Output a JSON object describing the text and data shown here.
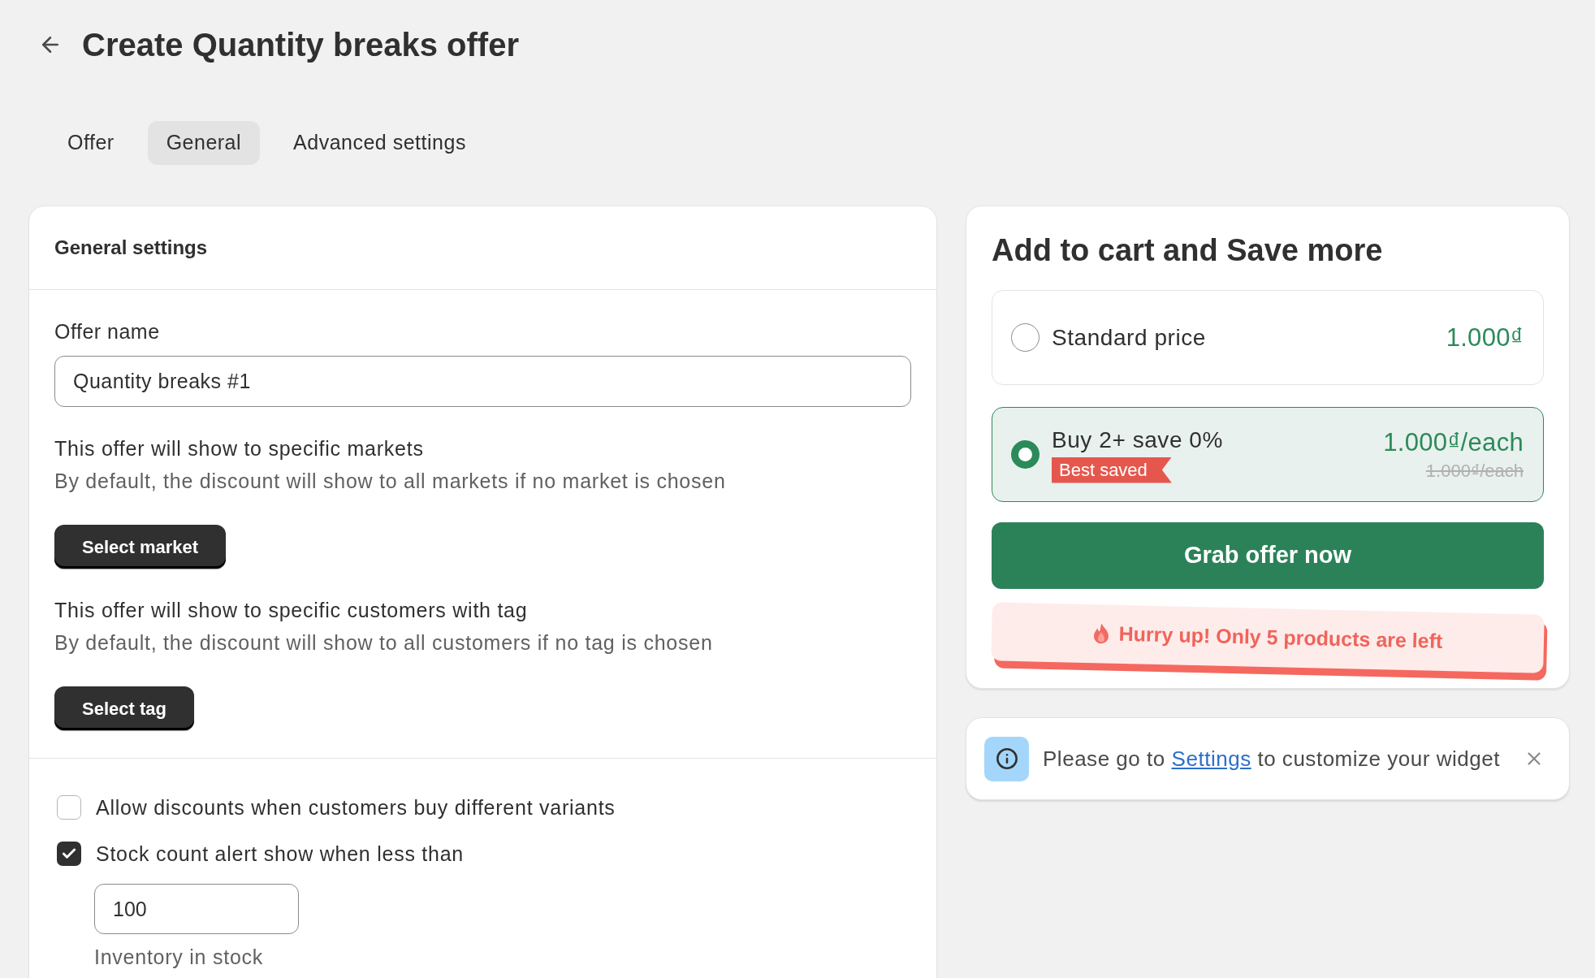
{
  "header": {
    "title": "Create Quantity breaks offer"
  },
  "tabs": [
    {
      "label": "Offer",
      "selected": false
    },
    {
      "label": "General",
      "selected": true
    },
    {
      "label": "Advanced settings",
      "selected": false
    }
  ],
  "general_settings": {
    "title": "General settings",
    "offer_name": {
      "label": "Offer name",
      "value": "Quantity breaks #1"
    },
    "targeting": [
      {
        "title": "This offer will show to specific markets",
        "description": "By default, the discount will show to all markets if no market is chosen",
        "button": "Select market"
      },
      {
        "title": "This offer will show to specific customers with tag",
        "description": "By default, the discount will show to all customers if no tag is chosen",
        "button": "Select tag"
      }
    ],
    "options": [
      {
        "label": "Allow discounts when customers buy different variants",
        "checked": false
      },
      {
        "label": "Stock count alert show when less than",
        "checked": true,
        "threshold": {
          "value": "100",
          "help": "Inventory in stock"
        }
      }
    ]
  },
  "preview": {
    "title": "Add to cart and Save more",
    "offers": [
      {
        "label": "Standard price",
        "price": "1.000₫",
        "selected": false
      },
      {
        "label": "Buy 2+ save 0%",
        "badge": "Best saved",
        "price": "1.000₫/each",
        "original_price": "1.000₫/each",
        "selected": true
      }
    ],
    "button": "Grab offer now",
    "stock_alert": "Hurry up! Only 5 products are left"
  },
  "notice": {
    "text_before": "Please go to",
    "link": "Settings",
    "text_after": "to customize your widget"
  }
}
